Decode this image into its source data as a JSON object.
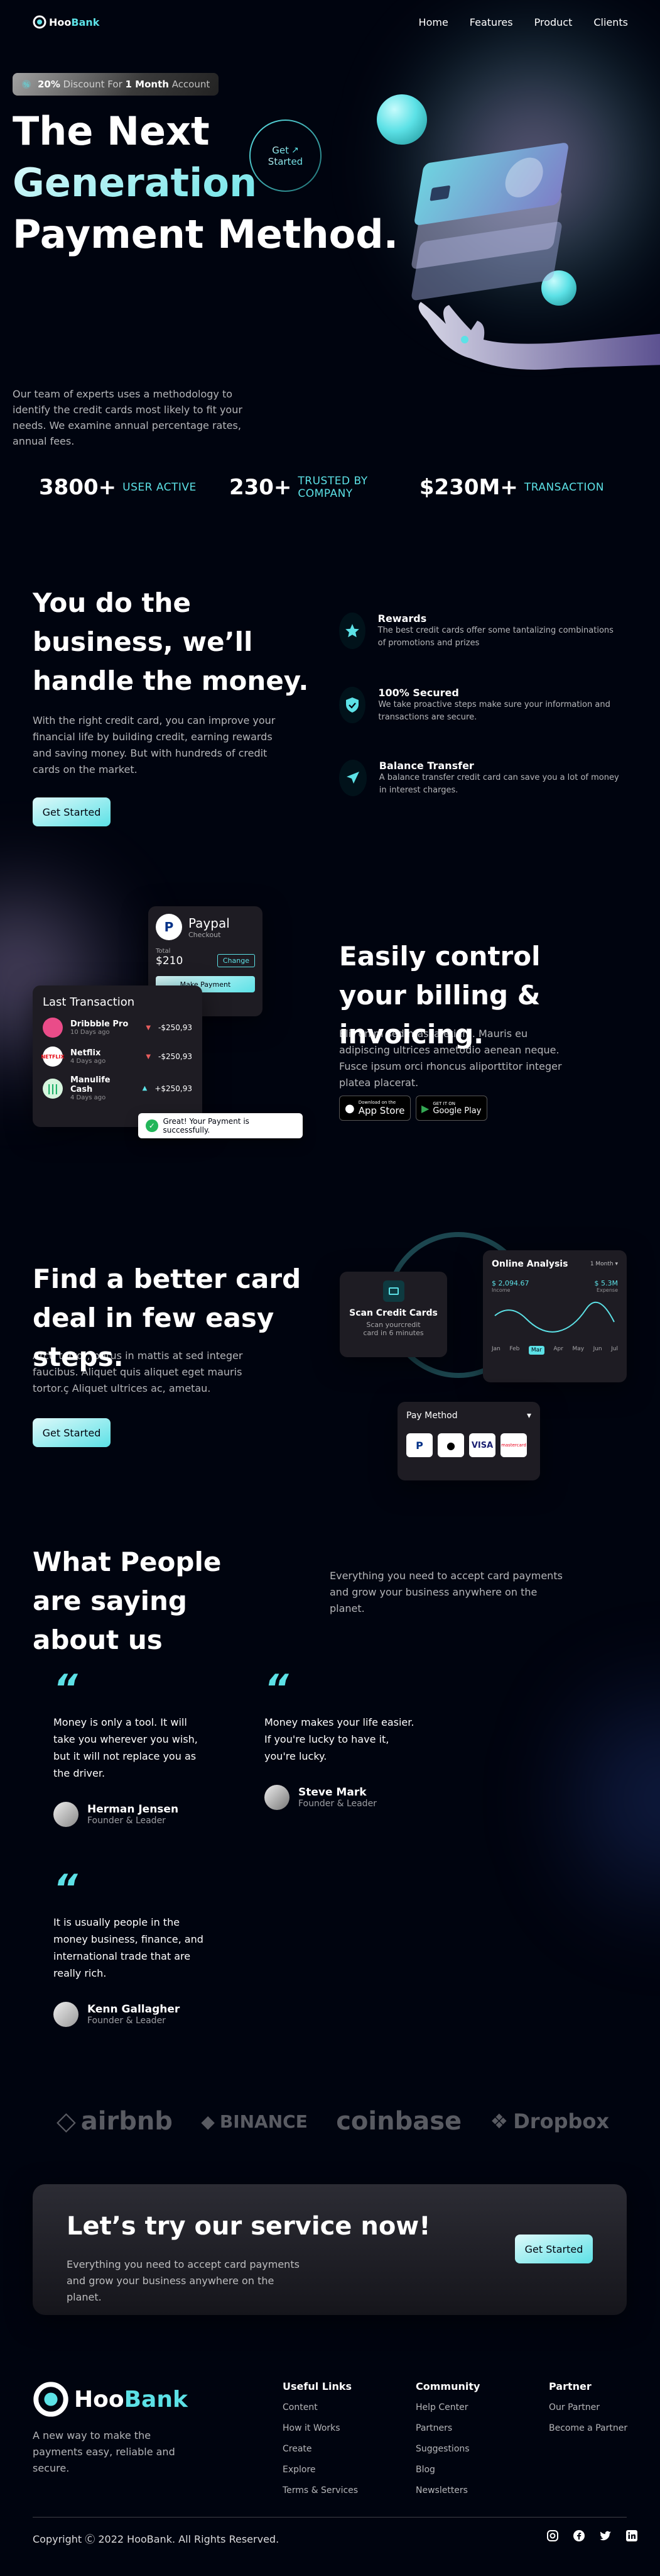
{
  "nav": {
    "brand_prefix": "Hoo",
    "brand_suffix": "Bank",
    "links": [
      "Home",
      "Features",
      "Product",
      "Clients"
    ]
  },
  "hero": {
    "discount_bold_1": "20%",
    "discount_text_1": " Discount For ",
    "discount_bold_2": "1 Month",
    "discount_text_2": " Account",
    "title_line1": "The Next",
    "title_line2": "Generation",
    "title_line3": "Payment Method.",
    "cta_line1": "Get",
    "cta_line2": "Started",
    "description": "Our team of experts uses a methodology to identify the credit cards most likely to fit your needs. We examine annual percentage rates, annual fees."
  },
  "stats": [
    {
      "value": "3800+",
      "label": "USER ACTIVE"
    },
    {
      "value": "230+",
      "label": "TRUSTED BY COMPANY"
    },
    {
      "value": "$230M+",
      "label": "TRANSACTION"
    }
  ],
  "business": {
    "title": "You do the business, we’ll handle the money.",
    "text": "With the right credit card, you can improve your financial life by building credit, earning rewards and saving money. But with hundreds of credit cards on the market.",
    "button": "Get Started",
    "features": [
      {
        "title": "Rewards",
        "text": "The best credit cards offer some tantalizing combinations of promotions and prizes",
        "icon": "star-icon"
      },
      {
        "title": "100% Secured",
        "text": "We take proactive steps make sure your information and transactions are secure.",
        "icon": "shield-icon"
      },
      {
        "title": "Balance Transfer",
        "text": "A balance transfer credit card can save you a lot of money in interest charges.",
        "icon": "send-icon"
      }
    ]
  },
  "billing": {
    "title": "Easily control your billing & invoicing.",
    "text": "Elit enim sed massa etiam. Mauris eu adipiscing ultrices ametodio aenean neque. Fusce ipsum orci rhoncus aliporttitor integer platea placerat.",
    "appstore_small": "Download on the",
    "appstore_big": "App Store",
    "googleplay_small": "GET IT ON",
    "googleplay_big": "Google Play",
    "paypal": {
      "name": "Paypal",
      "sub": "Checkout",
      "total_label": "Total",
      "total": "$210",
      "change": "Change",
      "button": "Make Payment"
    },
    "transactions": {
      "title": "Last Transaction",
      "items": [
        {
          "name": "Dribbble Pro",
          "time": "10 Days ago",
          "amount": "-$250,93"
        },
        {
          "name": "Netflix",
          "time": "4 Days ago",
          "amount": "-$250,93"
        },
        {
          "name": "Manulife Cash",
          "time": "4 Days ago",
          "amount": "+$250,93"
        }
      ]
    },
    "toast": "Great! Your Payment is successfully."
  },
  "carddeal": {
    "title": "Find a better card deal in few easy steps.",
    "text": "Arcu tortor, purus in mattis at sed integer faucibus. Aliquet quis aliquet eget mauris tortor.ç Aliquet ultrices ac, ametau.",
    "button": "Get Started",
    "scan_title": "Scan Credit Cards",
    "scan_text": "Scan yourcredit card in 6 minutes",
    "analysis": {
      "title": "Online Analysis",
      "period": "1 Month",
      "income": "$ 2,094.67",
      "income_label": "Income",
      "expense": "$ 5.3M",
      "expense_label": "Expense",
      "months": [
        "Jan",
        "Feb",
        "Mar",
        "Apr",
        "May",
        "Jun",
        "Jul"
      ],
      "active_month": "Mar"
    },
    "pay_method": {
      "title": "Pay Method",
      "options": [
        "P",
        "",
        "VISA",
        "mastercard"
      ]
    }
  },
  "testimonials": {
    "title": "What People are saying about us",
    "intro": "Everything you need to accept card payments and grow your business anywhere on the planet.",
    "items": [
      {
        "quote": "Money is only a tool. It will take you wherever you wish, but it will not replace you as the driver.",
        "name": "Herman Jensen",
        "role": "Founder & Leader"
      },
      {
        "quote": "Money makes your life easier. If you're lucky to have it, you're lucky.",
        "name": "Steve Mark",
        "role": "Founder & Leader"
      },
      {
        "quote": "It is usually people in the money business, finance, and international trade that are really rich.",
        "name": "Kenn Gallagher",
        "role": "Founder & Leader"
      }
    ]
  },
  "clients": [
    "airbnb",
    "BINANCE",
    "coinbase",
    "Dropbox"
  ],
  "cta": {
    "title": "Let’s try our service now!",
    "text": "Everything you need to accept card payments and grow your business anywhere on the planet.",
    "button": "Get Started"
  },
  "footer": {
    "tagline": "A new way to make the payments easy, reliable and secure.",
    "columns": [
      {
        "title": "Useful Links",
        "links": [
          "Content",
          "How it Works",
          "Create",
          "Explore",
          "Terms & Services"
        ]
      },
      {
        "title": "Community",
        "links": [
          "Help Center",
          "Partners",
          "Suggestions",
          "Blog",
          "Newsletters"
        ]
      },
      {
        "title": "Partner",
        "links": [
          "Our Partner",
          "Become a Partner"
        ]
      }
    ],
    "copyright": "Copyright Ⓒ 2022 HooBank. All Rights Reserved."
  }
}
